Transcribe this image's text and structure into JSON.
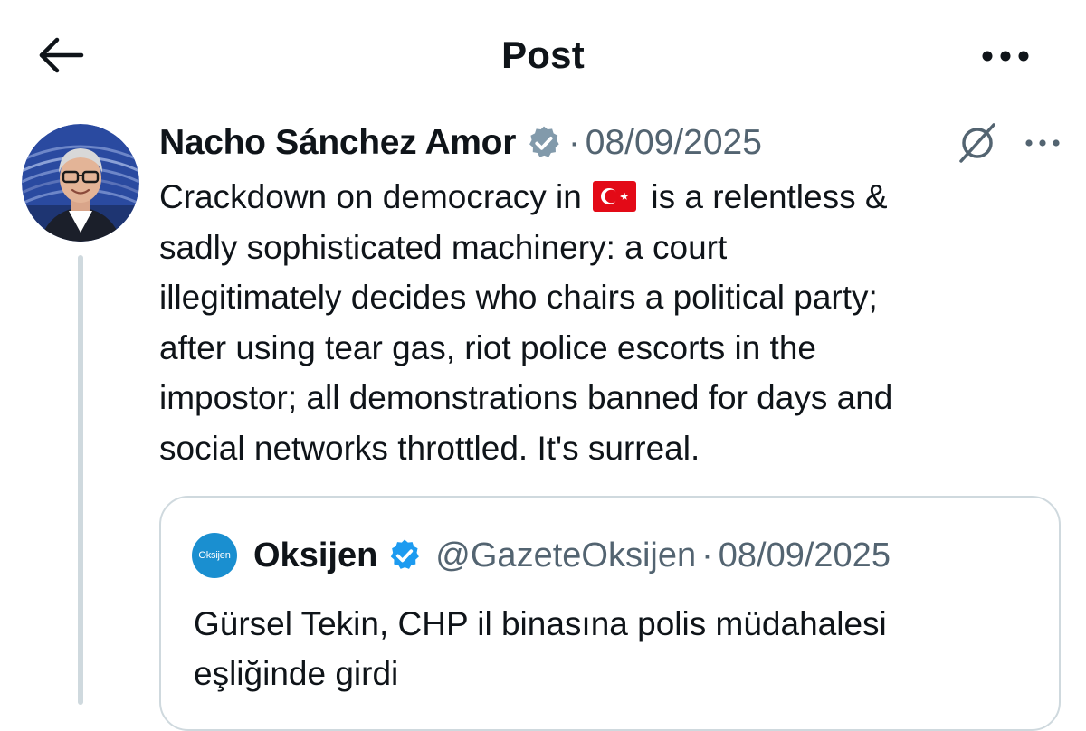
{
  "header": {
    "title": "Post",
    "back_icon": "arrow-left-icon",
    "more_icon": "more-horizontal-icon"
  },
  "tweet": {
    "author_name": "Nacho Sánchez Amor",
    "verified_badge": "gray-verified-badge-icon",
    "separator": "·",
    "date": "08/09/2025",
    "text_lines": [
      {
        "before": "Crackdown on democracy in",
        "flag": "turkey-flag-icon",
        "after": "is a relentless &"
      },
      "sadly sophisticated machinery: a court",
      "illegitimately decides who chairs a political party;",
      "after using tear gas, riot police escorts in the",
      "impostor; all demonstrations banned for days and",
      "social networks throttled. It's surreal."
    ]
  },
  "quote": {
    "avatar_text": "Oksijen",
    "name": "Oksijen",
    "verified_badge": "blue-verified-badge-icon",
    "handle": "@GazeteOksijen",
    "separator": "·",
    "date": "08/09/2025",
    "text_lines": [
      "Gürsel Tekin, CHP il binasına polis müdahalesi",
      "eşliğinde girdi"
    ]
  },
  "colors": {
    "text_primary": "#0f1419",
    "text_secondary": "#536471",
    "border": "#cfd9de",
    "verified_blue": "#1d9bf0",
    "verified_gray": "#829aab",
    "oksijen_brand": "#1a8fd0",
    "turkey_red": "#e30a17"
  }
}
